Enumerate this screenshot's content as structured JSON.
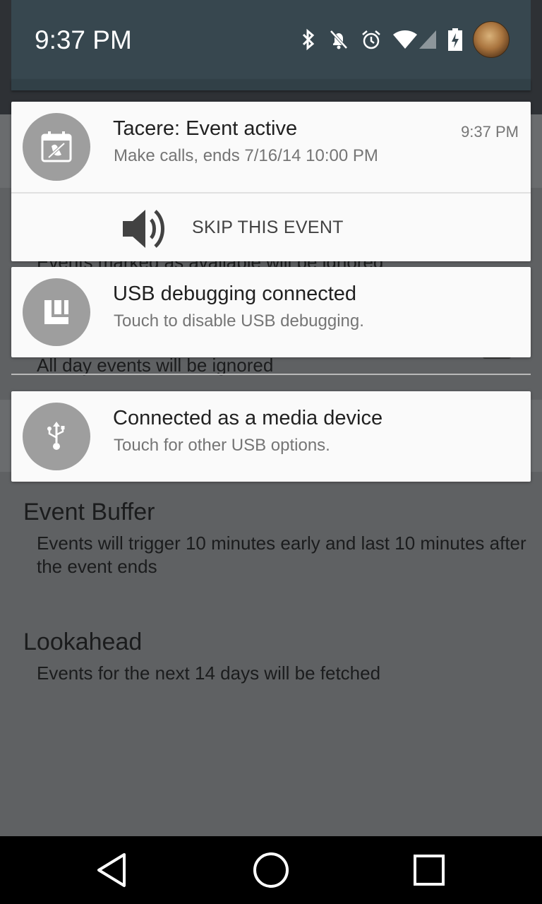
{
  "status_bar": {
    "time": "9:37 PM",
    "icons": [
      "bluetooth-icon",
      "notifications-muted-icon",
      "alarm-icon",
      "wifi-icon",
      "cell-signal-icon",
      "battery-charging-icon",
      "user-avatar"
    ]
  },
  "background_app": {
    "partial_text_top": "Events marked as available will be ignored",
    "partial_text_allday": "All day events will be ignored",
    "settings": [
      {
        "title": "Event Buffer",
        "summary": "Events will trigger 10 minutes early and last 10 minutes after the event ends"
      },
      {
        "title": "Lookahead",
        "summary": "Events for the next 14 days will be fetched"
      }
    ]
  },
  "notifications": [
    {
      "icon": "calendar-mute-icon",
      "title": "Tacere: Event active",
      "text": "Make calls, ends 7/16/14 10:00 PM",
      "time": "9:37 PM",
      "action": {
        "icon": "volume-icon",
        "label": "SKIP THIS EVENT"
      }
    },
    {
      "icon": "usb-debugging-icon",
      "title": "USB debugging connected",
      "text": "Touch to disable USB debugging."
    },
    {
      "icon": "usb-icon",
      "title": "Connected as a media device",
      "text": "Touch for other USB options."
    }
  ],
  "navbar": {
    "buttons": [
      "back-button",
      "home-button",
      "recents-button"
    ]
  },
  "colors": {
    "shade_header": "#37474f",
    "card_bg": "#fafafa",
    "icon_circle": "#9e9e9e",
    "scrim": "#5f6163"
  }
}
